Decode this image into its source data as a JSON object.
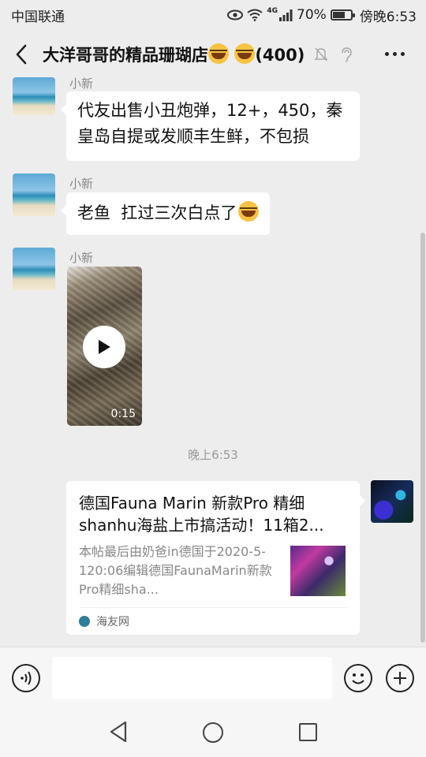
{
  "status_bar": {
    "carrier": "中国联通",
    "network": "4G",
    "battery": "70%",
    "battery_level": 0.7,
    "time": "傍晚6:53"
  },
  "header": {
    "title": "大洋哥哥的精品珊瑚店",
    "member_count": "(400)"
  },
  "messages": [
    {
      "sender": "小新",
      "text": "代友出售小丑炮弹，12+，450，秦皇岛自提或发顺丰生鲜，不包损"
    },
    {
      "sender": "小新",
      "text": "老鱼  扛过三次白点了"
    },
    {
      "sender": "小新",
      "video_duration": "0:15"
    }
  ],
  "timestamp": "晚上6:53",
  "shared_link": {
    "title": "德国Fauna Marin 新款Pro 精细shanhu海盐上市搞活动！11箱2...",
    "description": "本帖最后由奶爸in德国于2020-5-120:06编辑德国FaunaMarin新款Pro精细sha...",
    "source": "海友网"
  },
  "input": {
    "value": ""
  },
  "icons": {
    "back": "chevron-left-icon",
    "mute": "bell-off-icon",
    "earpiece": "ear-icon",
    "more": "more-dots-icon",
    "voice": "voice-icon",
    "emoji": "emoji-icon",
    "plus": "plus-icon",
    "play": "play-icon"
  }
}
